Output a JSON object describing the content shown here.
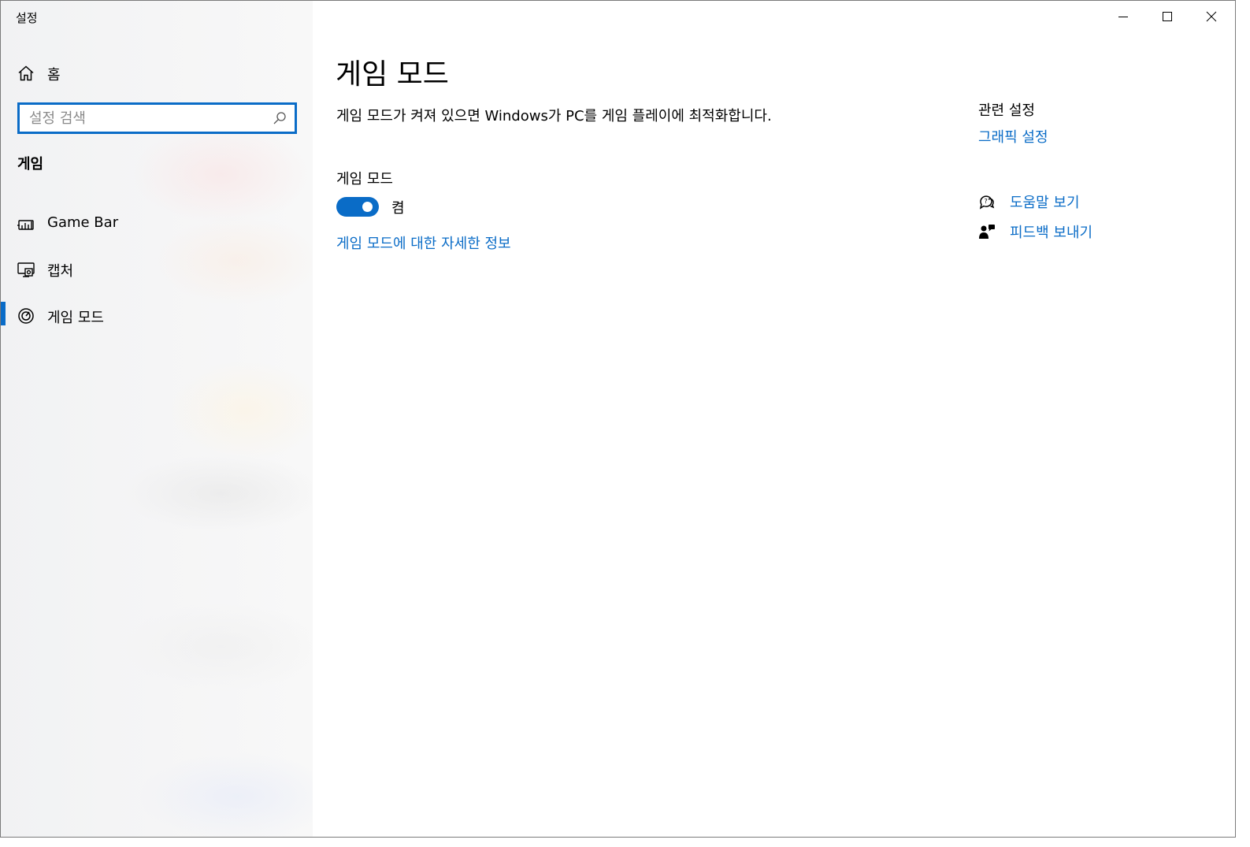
{
  "window": {
    "title": "설정"
  },
  "sidebar": {
    "home_label": "홈",
    "search_placeholder": "설정 검색",
    "section_title": "게임",
    "items": [
      {
        "label": "Game Bar",
        "icon": "game-bar-icon"
      },
      {
        "label": "캡처",
        "icon": "capture-icon"
      },
      {
        "label": "게임 모드",
        "icon": "game-mode-icon",
        "active": true
      }
    ]
  },
  "main": {
    "title": "게임 모드",
    "description": "게임 모드가 켜져 있으면 Windows가 PC를 게임 플레이에 최적화합니다.",
    "setting_label": "게임 모드",
    "toggle_state": "켬",
    "toggle_on": true,
    "more_info_link": "게임 모드에 대한 자세한 정보"
  },
  "related": {
    "title": "관련 설정",
    "graphics_link": "그래픽 설정",
    "help_link": "도움말 보기",
    "feedback_link": "피드백 보내기"
  },
  "colors": {
    "accent": "#0a6cc7"
  }
}
